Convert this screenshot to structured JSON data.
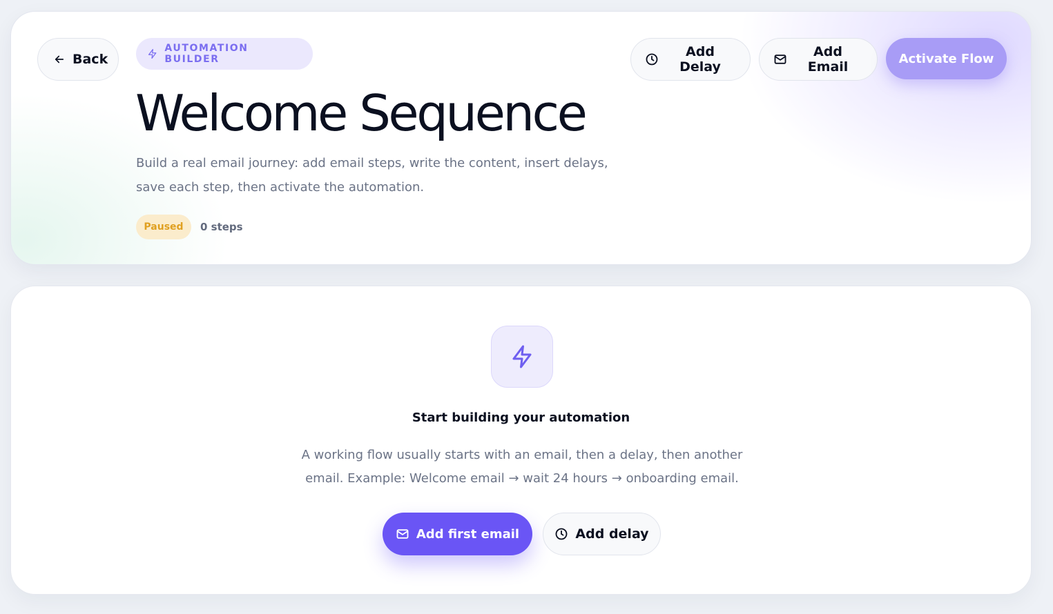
{
  "header": {
    "back_label": "Back",
    "badge_label": "AUTOMATION BUILDER",
    "title": "Welcome Sequence",
    "subtitle": "Build a real email journey: add email steps, write the content, insert delays, save each step, then activate the automation.",
    "status": "Paused",
    "steps_count": "0 steps",
    "actions": {
      "add_delay_label": "Add Delay",
      "add_email_label": "Add Email",
      "activate_label": "Activate Flow"
    }
  },
  "empty_state": {
    "icon": "lightning-bolt-icon",
    "title": "Start building your automation",
    "description": "A working flow usually starts with an email, then a delay, then another email. Example: Welcome email → wait 24 hours → onboarding email.",
    "primary_label": "Add first email",
    "secondary_label": "Add delay"
  },
  "colors": {
    "accent": "#6a55f5",
    "accent_soft": "#a89cf6",
    "badge_bg": "#ebe8fd",
    "status_bg": "#fbeccc",
    "status_text": "#e0a021",
    "muted_text": "#6b7386"
  }
}
